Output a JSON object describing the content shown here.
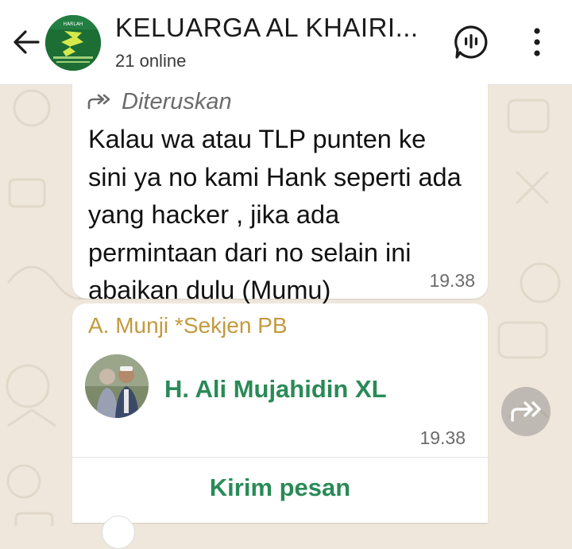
{
  "header": {
    "title": "KELUARGA AL KHAIRI...",
    "status": "21 online",
    "avatar_label": "HARLAH"
  },
  "messages": [
    {
      "forwarded_label": "Diteruskan",
      "text": "Kalau wa atau TLP punten ke sini ya no kami Hank seperti ada yang hacker , jika ada permintaan dari no selain ini abaikan dulu (Mumu)",
      "time": "19.38"
    }
  ],
  "contact_card": {
    "sender": "A. Munji *Sekjen PB",
    "contact_name": "H. Ali Mujahidin XL",
    "time": "19.38",
    "action_label": "Kirim pesan"
  },
  "colors": {
    "header_bg": "#ffffff",
    "chat_bg": "#efe7dc",
    "bubble_bg": "#ffffff",
    "accent_green": "#2a8a57",
    "sender_gold": "#c29a3f"
  }
}
